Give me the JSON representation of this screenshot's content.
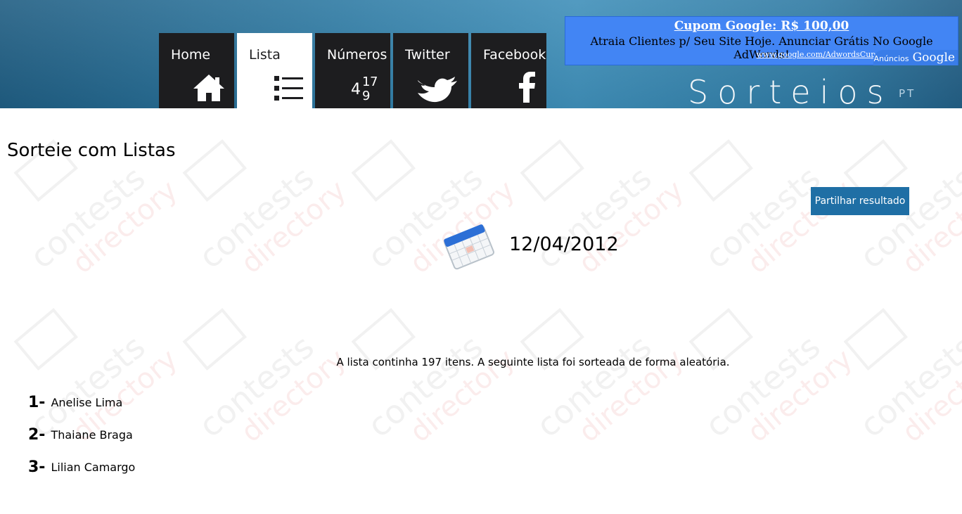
{
  "nav": {
    "tabs": [
      {
        "label": "Home",
        "icon": "home-icon"
      },
      {
        "label": "Lista",
        "icon": "list-icon",
        "active": true
      },
      {
        "label": "Números",
        "icon": "numbers-icon",
        "icon_glyph_a": "4",
        "icon_glyph_b": "1",
        "icon_glyph_c": "7",
        "icon_glyph_d": "9"
      },
      {
        "label": "Twitter",
        "icon": "twitter-bird-icon"
      },
      {
        "label": "Facebook",
        "icon": "facebook-f-icon"
      }
    ]
  },
  "ad": {
    "title": "Cupom Google: R$ 100,00",
    "text": "Atraia Clientes p/ Seu Site Hoje. Anunciar Grátis No Google AdWords!",
    "url": "www.google.com/AdwordsCupom",
    "badge_small": "Anúncios",
    "badge_brand": "Google"
  },
  "logo": {
    "text": "Sorteios",
    "sup": "PT"
  },
  "watermark": {
    "line1": "contests",
    "line2": "directory"
  },
  "page": {
    "title": "Sorteie com Listas",
    "share_label": "Partilhar resultado",
    "date": "12/04/2012",
    "summary": "A lista continha 197 itens. A seguinte lista foi sorteada de forma aleatória."
  },
  "results": [
    {
      "num": "1-",
      "name": "Anelise Lima"
    },
    {
      "num": "2-",
      "name": "Thaiane Braga"
    },
    {
      "num": "3-",
      "name": "Lilian Camargo"
    }
  ],
  "colors": {
    "header": "#2e7aa3",
    "tab_dark": "#1d1d1f",
    "ad_bg": "#4285f4",
    "button": "#1f6fa5"
  }
}
